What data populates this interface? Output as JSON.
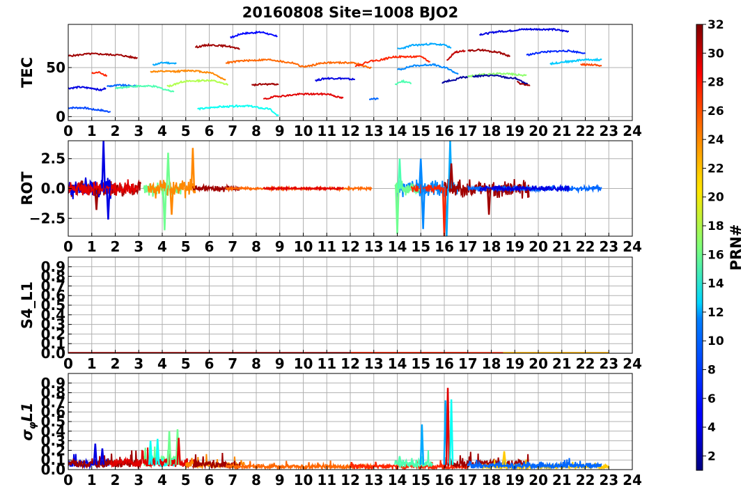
{
  "title": "20160808 Site=1008 BJO2",
  "chart_data": [
    {
      "type": "line",
      "ylabel": "TEC",
      "xlim": [
        0,
        24
      ],
      "ylim": [
        -4,
        94
      ],
      "yticks": [
        0,
        50
      ],
      "xticks": [
        "0",
        "1",
        "2",
        "3",
        "4",
        "5",
        "6",
        "7",
        "8",
        "9",
        "10",
        "11",
        "12",
        "13",
        "14",
        "15",
        "16",
        "17",
        "18",
        "19",
        "20",
        "21",
        "22",
        "23",
        "24"
      ],
      "grid": true,
      "series": [
        {
          "prn": 31,
          "x": [
            0.0,
            1.0,
            2.0,
            2.95
          ],
          "y": [
            62,
            64,
            63,
            60
          ]
        },
        {
          "prn": 4,
          "x": [
            0.0,
            0.5,
            1.0,
            1.4,
            1.6
          ],
          "y": [
            29,
            30,
            29,
            27,
            29
          ]
        },
        {
          "prn": 7,
          "x": [
            0.0,
            0.6,
            1.2,
            1.8
          ],
          "y": [
            9,
            9,
            7,
            5
          ]
        },
        {
          "prn": 27,
          "x": [
            1.0,
            1.3,
            1.65
          ],
          "y": [
            44,
            45,
            42
          ]
        },
        {
          "prn": 8,
          "x": [
            1.65,
            2.2,
            2.9
          ],
          "y": [
            31,
            32,
            31
          ]
        },
        {
          "prn": 15,
          "x": [
            2.0,
            2.8,
            3.5,
            4.5
          ],
          "y": [
            29,
            31,
            31,
            26
          ]
        },
        {
          "prn": 10,
          "x": [
            3.6,
            4.1,
            4.6
          ],
          "y": [
            53,
            55,
            54
          ]
        },
        {
          "prn": 24,
          "x": [
            3.5,
            4.5,
            5.2,
            6.0,
            6.7
          ],
          "y": [
            46,
            46,
            47,
            45,
            38
          ]
        },
        {
          "prn": 18,
          "x": [
            4.2,
            5.0,
            6.0,
            6.8
          ],
          "y": [
            31,
            36,
            37,
            33
          ]
        },
        {
          "prn": 13,
          "x": [
            5.5,
            6.5,
            7.5,
            8.5,
            8.95
          ],
          "y": [
            8,
            10,
            11,
            8,
            1
          ]
        },
        {
          "prn": 31,
          "x": [
            5.4,
            6.0,
            6.7,
            7.3
          ],
          "y": [
            71,
            73,
            72,
            69
          ]
        },
        {
          "prn": 25,
          "x": [
            6.7,
            7.5,
            8.5,
            9.5,
            10.0,
            11.0,
            12.0,
            12.9
          ],
          "y": [
            55,
            57,
            58,
            55,
            51,
            55,
            55,
            50
          ]
        },
        {
          "prn": 5,
          "x": [
            6.9,
            7.5,
            8.2,
            8.9
          ],
          "y": [
            81,
            85,
            86,
            82
          ]
        },
        {
          "prn": 31,
          "x": [
            7.8,
            8.3,
            8.95
          ],
          "y": [
            32,
            33,
            33
          ]
        },
        {
          "prn": 29,
          "x": [
            8.3,
            9.0,
            10.0,
            11.0,
            11.7
          ],
          "y": [
            18,
            21,
            23,
            23,
            19
          ]
        },
        {
          "prn": 4,
          "x": [
            10.5,
            11.0,
            11.5,
            12.2
          ],
          "y": [
            37,
            39,
            39,
            38
          ]
        },
        {
          "prn": 8,
          "x": [
            12.8,
            13.2
          ],
          "y": [
            18,
            18
          ]
        },
        {
          "prn": 27,
          "x": [
            12.2,
            13.0,
            14.0,
            15.0,
            15.4
          ],
          "y": [
            52,
            57,
            61,
            61,
            56
          ]
        },
        {
          "prn": 10,
          "x": [
            14.0,
            14.8,
            15.5,
            16.0,
            16.3
          ],
          "y": [
            69,
            73,
            74,
            73,
            70
          ]
        },
        {
          "prn": 9,
          "x": [
            14.0,
            14.8,
            15.5,
            16.0,
            16.6
          ],
          "y": [
            48,
            52,
            53,
            50,
            44
          ]
        },
        {
          "prn": 15,
          "x": [
            13.9,
            14.2,
            14.6
          ],
          "y": [
            33,
            36,
            34
          ]
        },
        {
          "prn": 30,
          "x": [
            16.1,
            16.5,
            16.9
          ],
          "y": [
            58,
            66,
            67
          ]
        },
        {
          "prn": 2,
          "x": [
            15.9,
            16.3,
            16.8,
            17.1
          ],
          "y": [
            35,
            37,
            40,
            41
          ]
        },
        {
          "prn": 17,
          "x": [
            17.0,
            17.7,
            18.5,
            19.5
          ],
          "y": [
            41,
            43,
            44,
            42
          ]
        },
        {
          "prn": 31,
          "x": [
            17.0,
            17.5,
            18.2,
            18.8
          ],
          "y": [
            67,
            68,
            66,
            62
          ]
        },
        {
          "prn": 2,
          "x": [
            17.2,
            18.0,
            19.0,
            19.55
          ],
          "y": [
            41,
            42,
            39,
            33
          ]
        },
        {
          "prn": 31,
          "x": [
            19.1,
            19.3,
            19.65
          ],
          "y": [
            36,
            33,
            32
          ]
        },
        {
          "prn": 4,
          "x": [
            17.5,
            18.5,
            19.5,
            20.5,
            21.3
          ],
          "y": [
            84,
            87,
            89,
            89,
            87
          ]
        },
        {
          "prn": 6,
          "x": [
            19.5,
            20.3,
            21.2,
            22.0
          ],
          "y": [
            63,
            66,
            67,
            65
          ]
        },
        {
          "prn": 11,
          "x": [
            20.5,
            21.2,
            22.0,
            22.7
          ],
          "y": [
            54,
            56,
            58,
            58
          ]
        },
        {
          "prn": 26,
          "x": [
            21.8,
            22.3,
            22.7
          ],
          "y": [
            53,
            53,
            52
          ]
        }
      ]
    },
    {
      "type": "line",
      "ylabel": "ROT",
      "xlim": [
        0,
        24
      ],
      "ylim": [
        -4,
        4
      ],
      "yticks": [
        "−2.5",
        "0.0",
        "2.5"
      ],
      "xticks": [
        "0",
        "1",
        "2",
        "3",
        "4",
        "5",
        "6",
        "7",
        "8",
        "9",
        "10",
        "11",
        "12",
        "13",
        "14",
        "15",
        "16",
        "17",
        "18",
        "19",
        "20",
        "21",
        "22",
        "23",
        "24"
      ],
      "grid": true,
      "series": [
        {
          "prn": 31,
          "t0": 0.0,
          "t1": 3.1,
          "amp": 0.6,
          "seed": 3
        },
        {
          "prn": 4,
          "t0": 0.0,
          "t1": 1.9,
          "amp": 0.8,
          "seed": 7
        },
        {
          "prn": 29,
          "t0": 0.0,
          "t1": 3.0,
          "amp": 0.6,
          "seed": 11
        },
        {
          "prn": 16,
          "t0": 3.2,
          "t1": 4.8,
          "amp": 0.6,
          "seed": 13
        },
        {
          "prn": 24,
          "t0": 3.4,
          "t1": 5.4,
          "amp": 0.7,
          "seed": 17
        },
        {
          "prn": 31,
          "t0": 5.3,
          "t1": 7.3,
          "amp": 0.25,
          "seed": 19
        },
        {
          "prn": 25,
          "t0": 6.7,
          "t1": 12.9,
          "amp": 0.1,
          "seed": 23
        },
        {
          "prn": 29,
          "t0": 8.3,
          "t1": 11.7,
          "amp": 0.08,
          "seed": 29
        },
        {
          "prn": 9,
          "t0": 14.0,
          "t1": 16.6,
          "amp": 0.7,
          "seed": 31
        },
        {
          "prn": 16,
          "t0": 13.9,
          "t1": 15.0,
          "amp": 0.6,
          "seed": 37
        },
        {
          "prn": 27,
          "t0": 14.6,
          "t1": 16.0,
          "amp": 0.4,
          "seed": 41
        },
        {
          "prn": 31,
          "t0": 16.0,
          "t1": 19.6,
          "amp": 0.7,
          "seed": 43
        },
        {
          "prn": 8,
          "t0": 17.0,
          "t1": 22.7,
          "amp": 0.2,
          "seed": 47
        },
        {
          "prn": 4,
          "t0": 17.5,
          "t1": 21.3,
          "amp": 0.2,
          "seed": 53
        }
      ],
      "spikes": [
        {
          "prn": 4,
          "x": 1.5,
          "y": 4.0
        },
        {
          "prn": 4,
          "x": 1.7,
          "y": -2.6
        },
        {
          "prn": 16,
          "x": 4.1,
          "y": -3.5
        },
        {
          "prn": 16,
          "x": 4.25,
          "y": 3.0
        },
        {
          "prn": 24,
          "x": 4.4,
          "y": -2.2
        },
        {
          "prn": 24,
          "x": 5.3,
          "y": 3.4
        },
        {
          "prn": 31,
          "x": 1.2,
          "y": -1.8
        },
        {
          "prn": 16,
          "x": 14.0,
          "y": -3.8
        },
        {
          "prn": 15,
          "x": 14.1,
          "y": 2.5
        },
        {
          "prn": 9,
          "x": 15.1,
          "y": -3.4
        },
        {
          "prn": 9,
          "x": 15.0,
          "y": 2.5
        },
        {
          "prn": 10,
          "x": 16.1,
          "y": -4.0
        },
        {
          "prn": 10,
          "x": 16.25,
          "y": 4.0
        },
        {
          "prn": 27,
          "x": 16.0,
          "y": -4.0
        },
        {
          "prn": 31,
          "x": 16.3,
          "y": 2.1
        },
        {
          "prn": 31,
          "x": 17.9,
          "y": -2.2
        }
      ]
    },
    {
      "type": "line",
      "ylabel": "S4_L1",
      "xlim": [
        0,
        24
      ],
      "ylim": [
        0,
        1.0
      ],
      "yticks": [
        "0.0",
        "0.1",
        "0.2",
        "0.3",
        "0.4",
        "0.5",
        "0.6",
        "0.7",
        "0.8",
        "0.9"
      ],
      "xticks": [
        "0",
        "1",
        "2",
        "3",
        "4",
        "5",
        "6",
        "7",
        "8",
        "9",
        "10",
        "11",
        "12",
        "13",
        "14",
        "15",
        "16",
        "17",
        "18",
        "19",
        "20",
        "21",
        "22",
        "23",
        "24"
      ],
      "grid": true,
      "series": [
        {
          "prn": 31,
          "x": [
            0.0,
            17.0
          ],
          "y": [
            0.005,
            0.005
          ]
        },
        {
          "prn": 27,
          "x": [
            12.0,
            23.0
          ],
          "y": [
            0.005,
            0.005
          ]
        },
        {
          "prn": 22,
          "x": [
            18.5,
            23.0
          ],
          "y": [
            0.004,
            0.004
          ]
        }
      ]
    },
    {
      "type": "line",
      "ylabel": "σφL1",
      "xlim": [
        0,
        24
      ],
      "ylim": [
        0,
        1.0
      ],
      "yticks": [
        "0.0",
        "0.1",
        "0.2",
        "0.3",
        "0.4",
        "0.5",
        "0.6",
        "0.7",
        "0.8",
        "0.9"
      ],
      "xticks": [
        "0",
        "1",
        "2",
        "3",
        "4",
        "5",
        "6",
        "7",
        "8",
        "9",
        "10",
        "11",
        "12",
        "13",
        "14",
        "15",
        "16",
        "17",
        "18",
        "19",
        "20",
        "21",
        "22",
        "23",
        "24"
      ],
      "grid": true,
      "series": [
        {
          "prn": 4,
          "t0": 0.0,
          "t1": 2.0,
          "base": 0.06,
          "seed": 5
        },
        {
          "prn": 31,
          "t0": 0.0,
          "t1": 3.1,
          "base": 0.06,
          "seed": 9
        },
        {
          "prn": 16,
          "t0": 3.2,
          "t1": 4.8,
          "base": 0.09,
          "seed": 15
        },
        {
          "prn": 13,
          "t0": 3.4,
          "t1": 4.6,
          "base": 0.08,
          "seed": 21
        },
        {
          "prn": 29,
          "t0": 1.8,
          "t1": 5.4,
          "base": 0.07,
          "seed": 27
        },
        {
          "prn": 24,
          "t0": 5.0,
          "t1": 7.5,
          "base": 0.05,
          "seed": 33
        },
        {
          "prn": 31,
          "t0": 5.3,
          "t1": 7.3,
          "base": 0.05,
          "seed": 39
        },
        {
          "prn": 25,
          "t0": 6.7,
          "t1": 12.9,
          "base": 0.03,
          "seed": 45
        },
        {
          "prn": 27,
          "t0": 12.0,
          "t1": 17.0,
          "base": 0.03,
          "seed": 51
        },
        {
          "prn": 15,
          "t0": 13.9,
          "t1": 15.5,
          "base": 0.06,
          "seed": 57
        },
        {
          "prn": 31,
          "t0": 16.0,
          "t1": 19.6,
          "base": 0.06,
          "seed": 63
        },
        {
          "prn": 22,
          "t0": 17.5,
          "t1": 23.0,
          "base": 0.03,
          "seed": 69
        },
        {
          "prn": 8,
          "t0": 17.0,
          "t1": 22.7,
          "base": 0.04,
          "seed": 75
        }
      ],
      "spikes": [
        {
          "prn": 4,
          "x": 1.15,
          "y": 0.27
        },
        {
          "prn": 4,
          "x": 1.45,
          "y": 0.22
        },
        {
          "prn": 13,
          "x": 3.5,
          "y": 0.3
        },
        {
          "prn": 13,
          "x": 3.8,
          "y": 0.32
        },
        {
          "prn": 16,
          "x": 4.3,
          "y": 0.4
        },
        {
          "prn": 16,
          "x": 4.65,
          "y": 0.42
        },
        {
          "prn": 29,
          "x": 4.7,
          "y": 0.33
        },
        {
          "prn": 10,
          "x": 15.05,
          "y": 0.47
        },
        {
          "prn": 10,
          "x": 16.05,
          "y": 0.72
        },
        {
          "prn": 29,
          "x": 16.15,
          "y": 0.85
        },
        {
          "prn": 13,
          "x": 16.3,
          "y": 0.73
        },
        {
          "prn": 22,
          "x": 18.55,
          "y": 0.19
        },
        {
          "prn": 15,
          "x": 14.1,
          "y": 0.14
        }
      ]
    }
  ],
  "colorbar": {
    "label": "PRN#",
    "min": 1,
    "max": 32,
    "ticks": [
      "2",
      "4",
      "6",
      "8",
      "10",
      "12",
      "14",
      "16",
      "18",
      "20",
      "22",
      "24",
      "26",
      "28",
      "30",
      "32"
    ],
    "colormap": "jet"
  }
}
